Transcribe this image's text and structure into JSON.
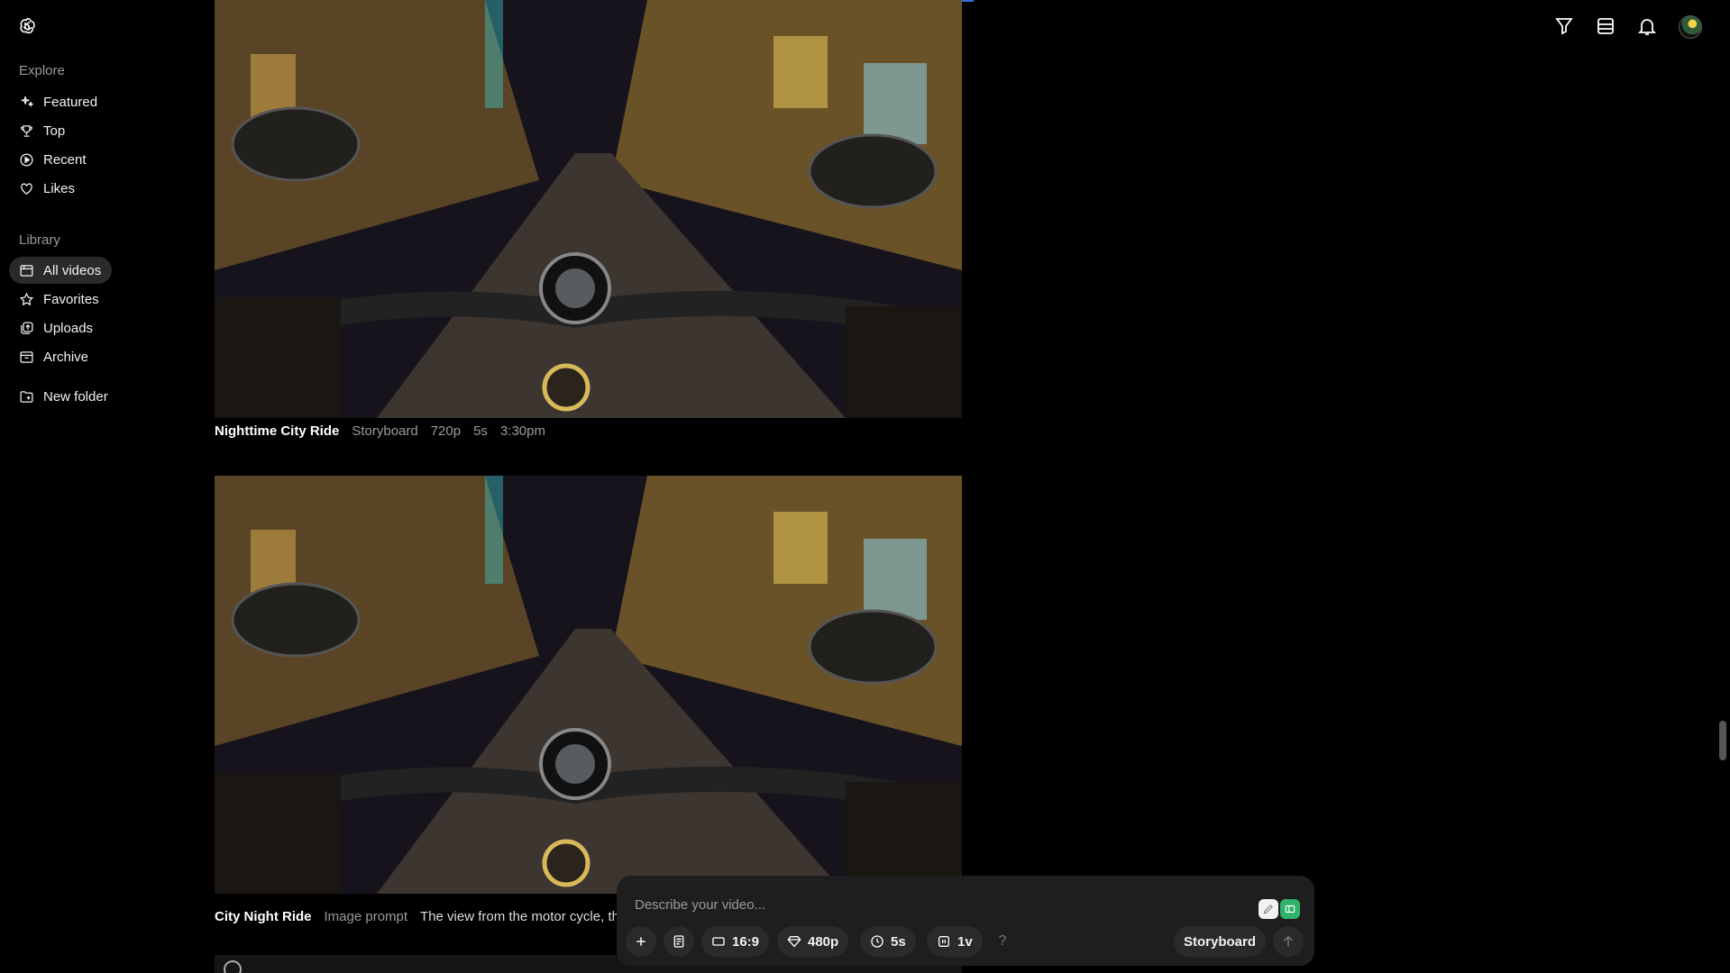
{
  "sidebar": {
    "explore_heading": "Explore",
    "explore_items": [
      {
        "label": "Featured",
        "icon": "sparkle-icon"
      },
      {
        "label": "Top",
        "icon": "trophy-icon"
      },
      {
        "label": "Recent",
        "icon": "play-circle-icon"
      },
      {
        "label": "Likes",
        "icon": "heart-icon"
      }
    ],
    "library_heading": "Library",
    "library_items": [
      {
        "label": "All videos",
        "icon": "grid-icon",
        "active": true
      },
      {
        "label": "Favorites",
        "icon": "star-icon"
      },
      {
        "label": "Uploads",
        "icon": "uploads-icon"
      },
      {
        "label": "Archive",
        "icon": "archive-icon"
      }
    ],
    "new_folder_label": "New folder"
  },
  "header": {
    "icons": [
      "filter-icon",
      "list-icon",
      "bell-icon",
      "avatar"
    ]
  },
  "videos": [
    {
      "title": "Nighttime City Ride",
      "type": "Storyboard",
      "resolution": "720p",
      "duration": "5s",
      "time": "3:30pm"
    },
    {
      "title": "City Night Ride",
      "type": "Image prompt",
      "prompt": "The view from the motor cycle, the"
    }
  ],
  "composer": {
    "placeholder": "Describe your video...",
    "aspect_ratio": "16:9",
    "resolution": "480p",
    "duration": "5s",
    "variations": "1v",
    "help": "?",
    "mode_label": "Storyboard"
  },
  "colors": {
    "background": "#000000",
    "composer_bg": "#1e1e1e",
    "chip_bg": "#2a2a2a",
    "accent_green": "#2fb36a"
  }
}
